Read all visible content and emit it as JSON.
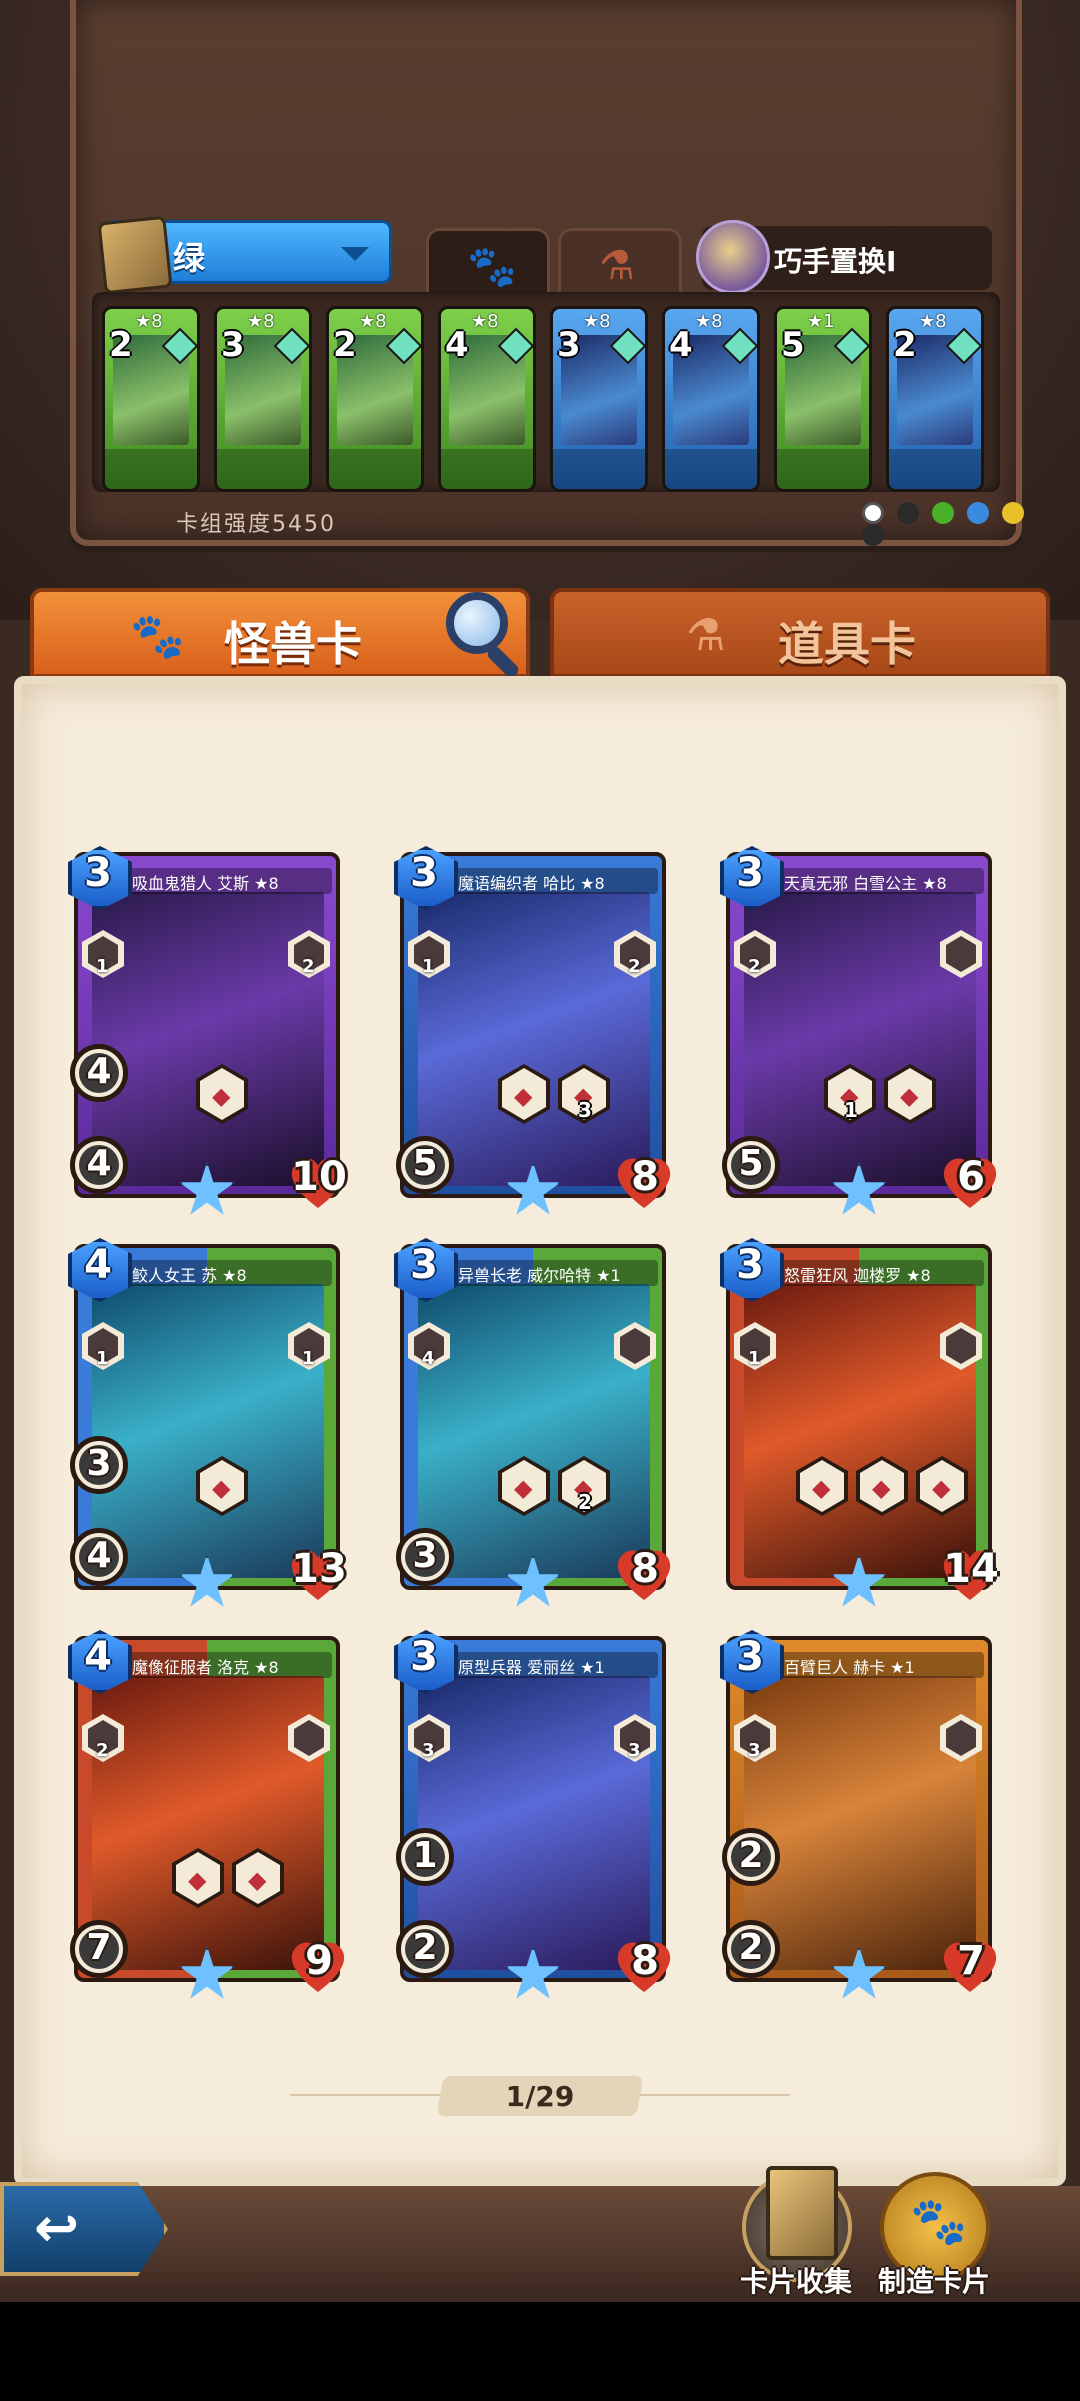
{
  "deck": {
    "selected_deck": "绿",
    "skill_name": "巧手置换I",
    "strength_label": "卡组强度5450",
    "mini_cards": [
      {
        "cost": "2",
        "stars": "★8",
        "color": "green"
      },
      {
        "cost": "3",
        "stars": "★8",
        "color": "green"
      },
      {
        "cost": "2",
        "stars": "★8",
        "color": "green"
      },
      {
        "cost": "4",
        "stars": "★8",
        "color": "green"
      },
      {
        "cost": "3",
        "stars": "★8",
        "color": "blue"
      },
      {
        "cost": "4",
        "stars": "★8",
        "color": "blue"
      },
      {
        "cost": "5",
        "stars": "★1",
        "color": "green"
      },
      {
        "cost": "2",
        "stars": "★8",
        "color": "blue"
      }
    ]
  },
  "tabs": {
    "monster_label": "怪兽卡",
    "item_label": "道具卡"
  },
  "cards": [
    {
      "name": "吸血鬼猎人 艾斯 ★8",
      "cost": "3",
      "left_top": "1",
      "right_top": "2",
      "left_mid": "4",
      "attack": "4",
      "hp": "10",
      "skills": [
        ""
      ],
      "theme": "purple"
    },
    {
      "name": "魔语编织者 哈比 ★8",
      "cost": "3",
      "left_top": "1",
      "right_top": "2",
      "left_mid": "",
      "attack": "5",
      "hp": "8",
      "skills": [
        "",
        "3"
      ],
      "theme": "blue"
    },
    {
      "name": "天真无邪 白雪公主 ★8",
      "cost": "3",
      "left_top": "2",
      "right_top": "",
      "left_mid": "",
      "attack": "5",
      "hp": "6",
      "skills": [
        "1",
        ""
      ],
      "theme": "purple"
    },
    {
      "name": "鲛人女王 苏 ★8",
      "cost": "4",
      "left_top": "1",
      "right_top": "1",
      "left_mid": "3",
      "attack": "4",
      "hp": "13",
      "skills": [
        ""
      ],
      "theme": "bluegreen"
    },
    {
      "name": "异兽长老 威尔哈特 ★1",
      "cost": "3",
      "left_top": "4",
      "right_top": "",
      "left_mid": "",
      "attack": "3",
      "hp": "8",
      "skills": [
        "",
        "2"
      ],
      "theme": "bluegreen"
    },
    {
      "name": "怒雷狂风 迦楼罗 ★8",
      "cost": "3",
      "left_top": "1",
      "right_top": "",
      "left_mid": "",
      "attack": "",
      "hp": "14",
      "skills": [
        "",
        "",
        ""
      ],
      "theme": "redgreen"
    },
    {
      "name": "魔像征服者 洛克 ★8",
      "cost": "4",
      "left_top": "2",
      "right_top": "",
      "left_mid": "",
      "attack": "7",
      "hp": "9",
      "skills": [
        "",
        ""
      ],
      "theme": "redgreen"
    },
    {
      "name": "原型兵器 爱丽丝 ★1",
      "cost": "3",
      "left_top": "3",
      "right_top": "3",
      "left_mid": "1",
      "attack": "2",
      "hp": "8",
      "skills": [],
      "theme": "blue"
    },
    {
      "name": "百臂巨人 赫卡 ★1",
      "cost": "3",
      "left_top": "3",
      "right_top": "",
      "left_mid": "2",
      "attack": "2",
      "hp": "7",
      "skills": [],
      "theme": "orange"
    }
  ],
  "pagination": {
    "label": "1/29"
  },
  "bottom": {
    "collect_label": "卡片收集",
    "make_label": "制造卡片"
  },
  "colors": {
    "accent_orange": "#e2742a",
    "parchment": "#f6ecdc",
    "deck_blue": "#2f8fe8"
  }
}
